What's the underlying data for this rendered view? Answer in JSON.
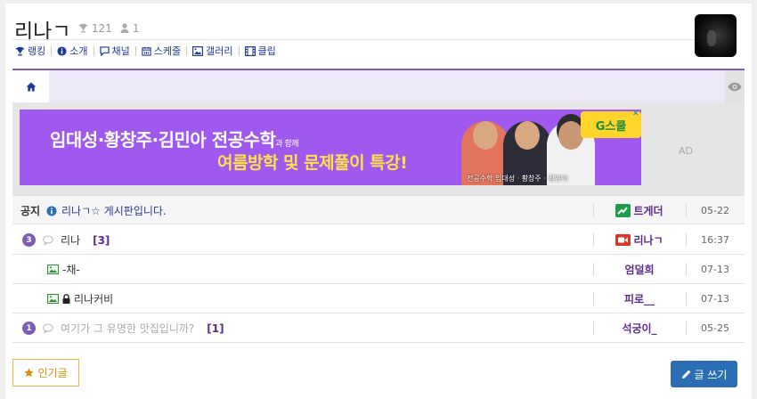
{
  "header": {
    "title": "리나ㄱ",
    "trophy_count": "121",
    "user_count": "1"
  },
  "nav": [
    {
      "icon": "trophy-icon",
      "label": "랭킹"
    },
    {
      "icon": "info-icon",
      "label": "소개"
    },
    {
      "icon": "chat-icon",
      "label": "채널"
    },
    {
      "icon": "calendar-icon",
      "label": "스케줄"
    },
    {
      "icon": "image-icon",
      "label": "갤러리"
    },
    {
      "icon": "film-icon",
      "label": "클립"
    }
  ],
  "ad": {
    "line1": "임대성·황창주·김민아 전공수학",
    "line1_small": "과 함께",
    "line2": "여름방학 및 문제풀이 특강!",
    "caption": "전공수학 임대성 · 황창주 · 김민아",
    "brand": "G스쿨",
    "label": "AD"
  },
  "notice": {
    "tag": "공지",
    "text": "리나ㄱ☆ 게시판입니다.",
    "author": "트게더",
    "date": "05-22"
  },
  "posts": [
    {
      "badge": "3",
      "title": "리나",
      "comments": "[3]",
      "author": "리나ㄱ",
      "date": "16:37"
    },
    {
      "title": "-채-",
      "author": "엄덜희",
      "date": "07-13"
    },
    {
      "title": "리나커비",
      "author": "피로__",
      "date": "07-13"
    },
    {
      "badge": "1",
      "title": "여기가 그 유명한 맛집입니까?",
      "comments": "[1]",
      "author": "석궁이_",
      "date": "05-25"
    }
  ],
  "buttons": {
    "popular": "인기글",
    "write": "글 쓰기"
  },
  "colors": {
    "accent_purple": "#7c5cb7",
    "link_blue": "#1f3a93",
    "write_button": "#2a6fb5",
    "popular_button": "#d59200"
  }
}
